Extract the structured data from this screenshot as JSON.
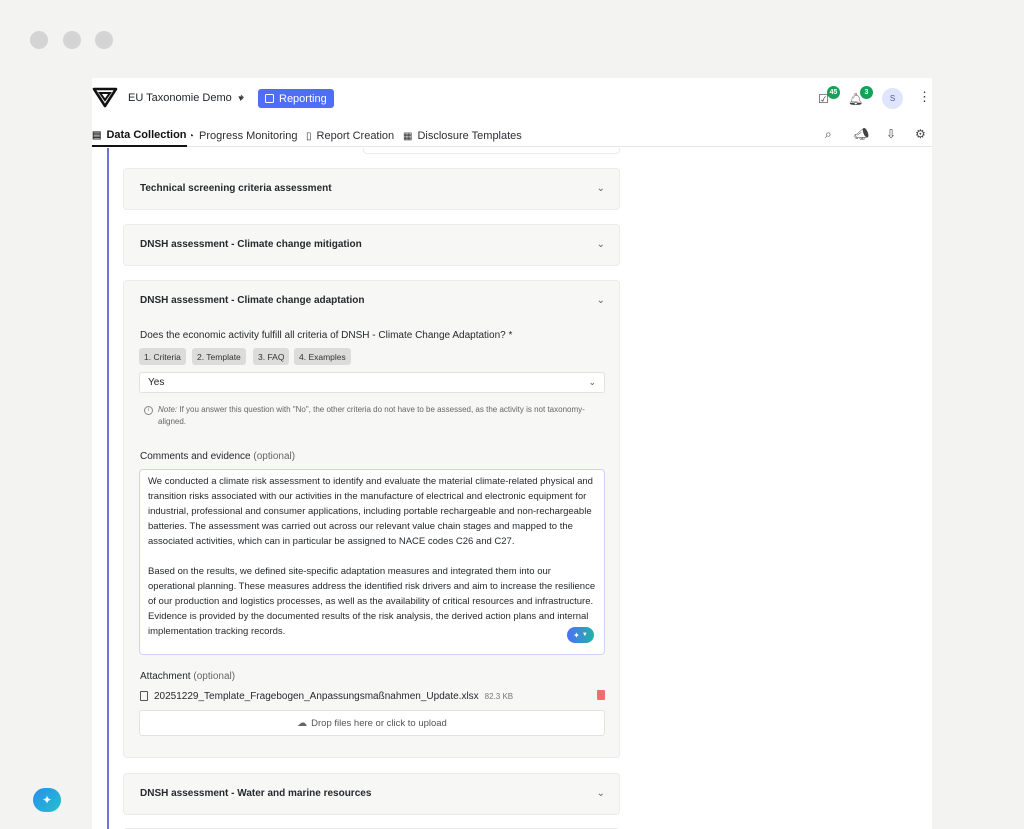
{
  "header": {
    "workspace": "EU Taxonomie Demo",
    "module": "Reporting",
    "tasks_count": "45",
    "notifications_count": "3",
    "avatar_initial": "S"
  },
  "nav": {
    "tabs": [
      {
        "label": "Data Collection",
        "icon": "clipboard-icon",
        "active": true
      },
      {
        "label": "Progress Monitoring",
        "icon": "gauge-icon",
        "active": false
      },
      {
        "label": "Report Creation",
        "icon": "document-icon",
        "active": false
      },
      {
        "label": "Disclosure Templates",
        "icon": "table-icon",
        "active": false
      }
    ],
    "tools": [
      "search-icon",
      "megaphone-icon",
      "export-icon",
      "gear-icon"
    ]
  },
  "sections": [
    {
      "title": "Technical screening criteria assessment",
      "expanded": false
    },
    {
      "title": "DNSH assessment - Climate change mitigation",
      "expanded": false
    },
    {
      "title": "DNSH assessment - Climate change adaptation",
      "expanded": true
    },
    {
      "title": "DNSH assessment - Water and marine resources",
      "expanded": false
    }
  ],
  "form": {
    "question": "Does the economic activity fulfill all criteria of DNSH - Climate Change Adaptation? *",
    "chips": [
      "1. Criteria",
      "2. Template",
      "3. FAQ",
      "4. Examples"
    ],
    "answer": "Yes",
    "note_label": "Note:",
    "note_text": "If you answer this question with \"No\", the other criteria do not have to be assessed, as the activity is not taxonomy-aligned.",
    "comments_label": "Comments and evidence",
    "optional": "(optional)",
    "comment_p1": "We conducted a climate risk assessment to identify and evaluate the material climate-related physical and transition risks associated with our activities in the manufacture of electrical and electronic equipment for industrial, professional and consumer applications, including portable rechargeable and non-rechargeable batteries. The assessment was carried out across our relevant value chain stages and mapped to the associated activities, which can in particular be assigned to NACE codes C26 and C27.",
    "comment_p2": "Based on the results, we defined site-specific adaptation measures and integrated them into our operational planning. These measures address the identified risk drivers and aim to increase the resilience of our production and logistics processes, as well as the availability of critical resources and infrastructure. Evidence is provided by the documented results of the risk analysis, the derived action plans and internal implementation tracking records.",
    "attachment_label": "Attachment",
    "file_name": "20251229_Template_Fragebogen_Anpassungsmaßnahmen_Update.xlsx",
    "file_size": "82.3 KB",
    "dropzone_text": "Drop files here or click to upload"
  },
  "colors": {
    "accent": "#4f6ef7",
    "badge": "#18a058",
    "rail": "#6b74d6",
    "delete": "#f26d6d"
  }
}
